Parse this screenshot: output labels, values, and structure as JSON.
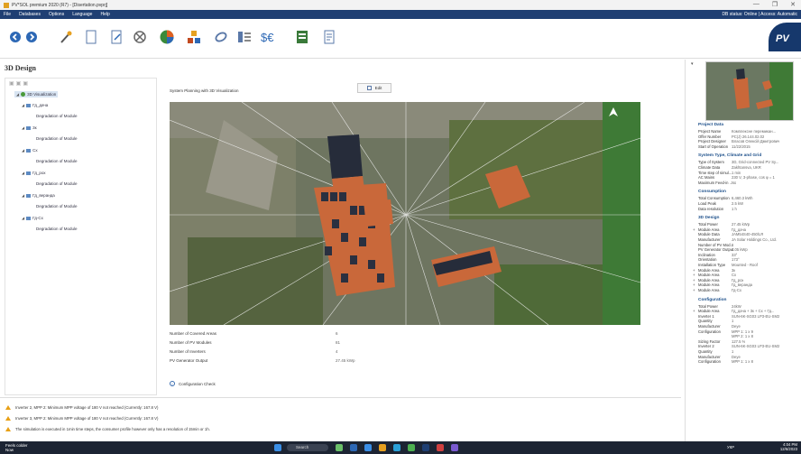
{
  "window": {
    "title": "PV*SOL premium 2020 (R7) - [Disertation.pvprj]",
    "controls": [
      "—",
      "❐",
      "✕"
    ]
  },
  "menu": {
    "items": [
      "File",
      "Databases",
      "Options",
      "Language",
      "Help"
    ],
    "status": "DB status: Online | Access: Automatic"
  },
  "brand": {
    "logo_text": "PV"
  },
  "page": {
    "title": "3D Design"
  },
  "tree": {
    "root": "3D Visualization",
    "areas": [
      {
        "name": "Гд_дача",
        "child": "Degradation of Module"
      },
      {
        "name": "3к",
        "child": "Degradation of Module"
      },
      {
        "name": "Сх",
        "child": "Degradation of Module"
      },
      {
        "name": "Гд_рох",
        "child": "Degradation of Module"
      },
      {
        "name": "Гд_веранда",
        "child": "Degradation of Module"
      },
      {
        "name": "Гд-Сх",
        "child": "Degradation of Module"
      }
    ]
  },
  "main": {
    "header": "System Planning with 3D Visualization",
    "edit_label": "Edit",
    "fields": [
      {
        "label": "Number of Covered Areas",
        "value": "6"
      },
      {
        "label": "Number of PV Modules",
        "value": "81"
      },
      {
        "label": "Number of Inverters",
        "value": "4"
      },
      {
        "label": "PV Generator Output",
        "value": "27.45 kWp"
      }
    ],
    "config_check": "Configuration Check"
  },
  "messages": [
    "Inverter 2, MPP 2:  Minimum MPP voltage of 180 V not reached (Currently: 167.8 V)",
    "Inverter 3, MPP 2:  Minimum MPP voltage of 180 V not reached (Currently: 167.8 V)",
    "The simulation is executed in 1min time steps, the consumer profile however only has a resolution of 15min or 1h."
  ],
  "right_panel": {
    "sections": [
      {
        "title": "Project Data",
        "rows": [
          [
            "Project Name",
            "Комплексне перемикан..."
          ],
          [
            "Offer Number",
            "PC(J) 26.144.02.02"
          ],
          [
            "Project Designer",
            "Власов Олексій Дмитрович"
          ],
          [
            "Start of Operation",
            "11/22/2015"
          ]
        ]
      },
      {
        "title": "System Type, Climate and Grid",
        "rows": [
          [
            "Type of System",
            "3D, Grid-connected PV Sy..."
          ],
          [
            "Climate Data",
            "Zakhtansva, UKR"
          ],
          [
            "Time step of simul...",
            "1 min"
          ],
          [
            "AC Mains",
            "230 V, 3-phase, cos φ = 1"
          ],
          [
            "Maximum Feed-in ...",
            "No"
          ]
        ]
      },
      {
        "title": "Consumption",
        "rows": [
          [
            "Total Consumption",
            "6,460.3 kWh"
          ],
          [
            "Load Peak",
            "2.5 kW"
          ],
          [
            "Data resolution",
            "1 h"
          ]
        ]
      },
      {
        "title": "3D Design",
        "rows": [
          [
            "Total Power",
            "27.45 kWp"
          ],
          [
            "Module Area",
            "Гд_дача",
            "+"
          ],
          [
            "Module Data",
            "JAM54S40-450/LR"
          ],
          [
            "Manufacturer",
            "JA Solar Holdings Co., Ltd."
          ],
          [
            "Number of PV Mod...",
            "9"
          ],
          [
            "PV Generator Output",
            "4.05 kWp"
          ],
          [
            "Inclination",
            "33°"
          ],
          [
            "Orientation",
            "173°"
          ],
          [
            "Installation Type",
            "Mounted - Roof"
          ],
          [
            "Module Area",
            "3к",
            "+"
          ],
          [
            "Module Area",
            "Сх",
            "+"
          ],
          [
            "Module Area",
            "Гд_рох",
            "+"
          ],
          [
            "Module Area",
            "Гд_веранда",
            "+"
          ],
          [
            "Module Area",
            "Гд-Сх",
            "+"
          ]
        ]
      },
      {
        "title": "Configuration",
        "rows": [
          [
            "Total Power",
            "24kW"
          ],
          [
            "Module Area",
            "Гд_дача + 3к + Сх + Гд...",
            "+"
          ],
          [
            "Inverter 1",
            "SUN-6K-SG03 LP3-EU-SM2"
          ],
          [
            "Quantity",
            "1"
          ],
          [
            "Manufacturer",
            "Deye"
          ],
          [
            "Configuration",
            "MPP 1: 1 x 9"
          ],
          [
            "",
            "MPP 2: 1 x 8"
          ],
          [
            "Sizing Factor",
            "127.5 %"
          ],
          [
            "Inverter 2",
            "SUN-6K-SG03 LP3-EU-SM2"
          ],
          [
            "Quantity",
            "1"
          ],
          [
            "Manufacturer",
            "Deye"
          ],
          [
            "Configuration",
            "MPP 1: 1 x 8"
          ]
        ]
      }
    ]
  },
  "taskbar": {
    "weather_line1": "Feels colder",
    "weather_line2": "Now",
    "search": "Search",
    "time": "4:04 PM",
    "date": "12/6/2023",
    "lang": "УКР"
  }
}
